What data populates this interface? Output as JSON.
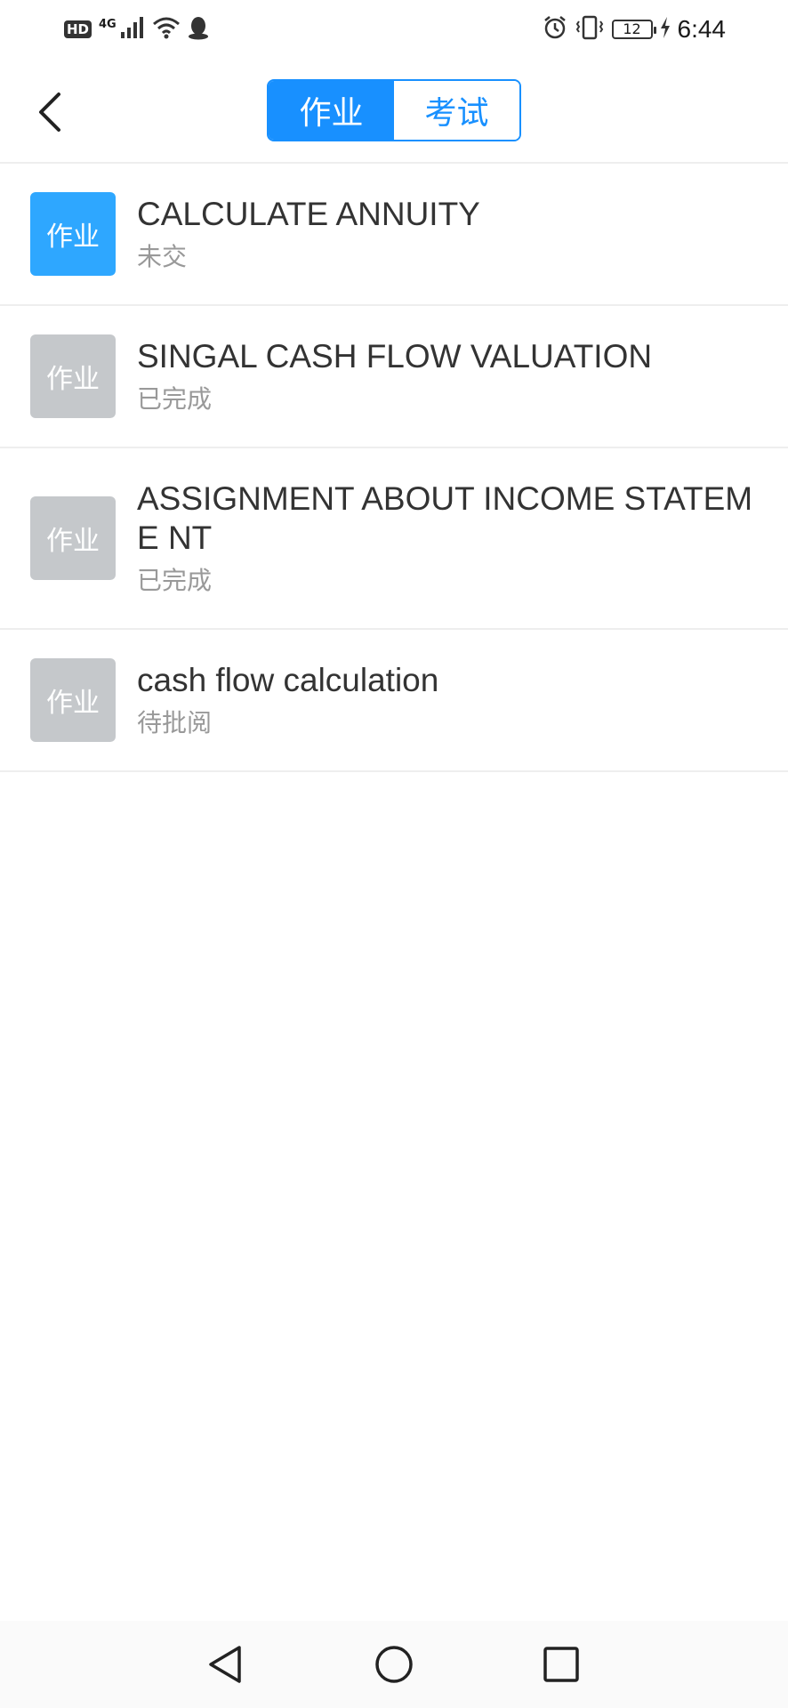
{
  "status_bar": {
    "hd": "HD",
    "network": "4G",
    "battery_level": "12",
    "time": "6:44"
  },
  "nav": {
    "tabs": [
      {
        "label": "作业",
        "active": true
      },
      {
        "label": "考试",
        "active": false
      }
    ]
  },
  "assignments": [
    {
      "badge": "作业",
      "title": "CALCULATE ANNUITY",
      "status": "未交",
      "badge_color": "#2ea7ff"
    },
    {
      "badge": "作业",
      "title": "SINGAL CASH FLOW VALUATION",
      "status": "已完成",
      "badge_color": "#c5c8cb"
    },
    {
      "badge": "作业",
      "title": "ASSIGNMENT ABOUT INCOME STATEME NT",
      "status": "已完成",
      "badge_color": "#c5c8cb"
    },
    {
      "badge": "作业",
      "title": "cash flow calculation",
      "status": "待批阅",
      "badge_color": "#c5c8cb"
    }
  ],
  "colors": {
    "accent": "#1890ff",
    "divider": "#eeeeee",
    "secondary_text": "#999999"
  },
  "icons": {
    "back": "chevron-left-icon",
    "sys_back": "triangle-back-icon",
    "sys_home": "circle-home-icon",
    "sys_recent": "square-recent-icon"
  }
}
